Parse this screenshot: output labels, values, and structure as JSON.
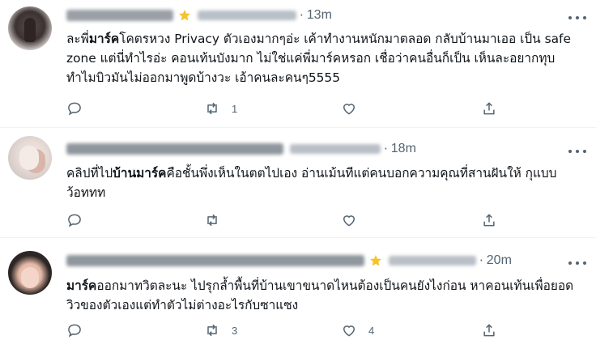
{
  "tweets": [
    {
      "time": "13m",
      "verified": true,
      "text_bold": "มาร์ค",
      "text_pre": "ละพี่",
      "text_post": "โคตรหวง Privacy ตัวเองมากๆอ่ะ เค้าทำงานหนักมาตลอด กลับบ้านมาเออ เป็น safe zone แต่นี่ทำไรอ่ะ คอนเท้นบังมาก ไม่ใช่แค่พี่มาร์คหรอก เชื่อว่าคนอื่นก็เป็น เห็นละอยากทุบ ทำไมบิวมันไม่ออกมาพูดบ้างวะ เอ้าคนละคนๆ5555",
      "reply_count": "",
      "retweet_count": "1",
      "like_count": ""
    },
    {
      "time": "18m",
      "verified": false,
      "text_pre": "คลิปที่ไป",
      "text_bold": "บ้านมาร์ค",
      "text_post": "คือชั้นพึ่งเห็นในตตไปเอง อ่านเม้นทีแต่คนบอกความคุณที่สานฝันให้ กุแบบ ว้อททท",
      "reply_count": "",
      "retweet_count": "",
      "like_count": ""
    },
    {
      "time": "20m",
      "verified": true,
      "text_pre": "",
      "text_bold": "มาร์ค",
      "text_post": "ออกมาทวิตละนะ ไปรุกล้ำพื้นที่บ้านเขาขนาดไหนต้องเป็นคนยังไงก่อน หาคอนเท้นเพื่อยอดวิวของตัวเองแต่ทำตัวไม่ต่างอะไรกับซาแซง",
      "reply_count": "",
      "retweet_count": "3",
      "like_count": "4"
    }
  ],
  "icons": {
    "reply": "reply-icon",
    "retweet": "retweet-icon",
    "like": "like-icon",
    "share": "share-icon",
    "more": "more-icon",
    "verified": "verified-badge-icon"
  },
  "colors": {
    "text": "#0f1419",
    "muted": "#536471",
    "divider": "#eff3f4",
    "verified": "#f4c430"
  }
}
